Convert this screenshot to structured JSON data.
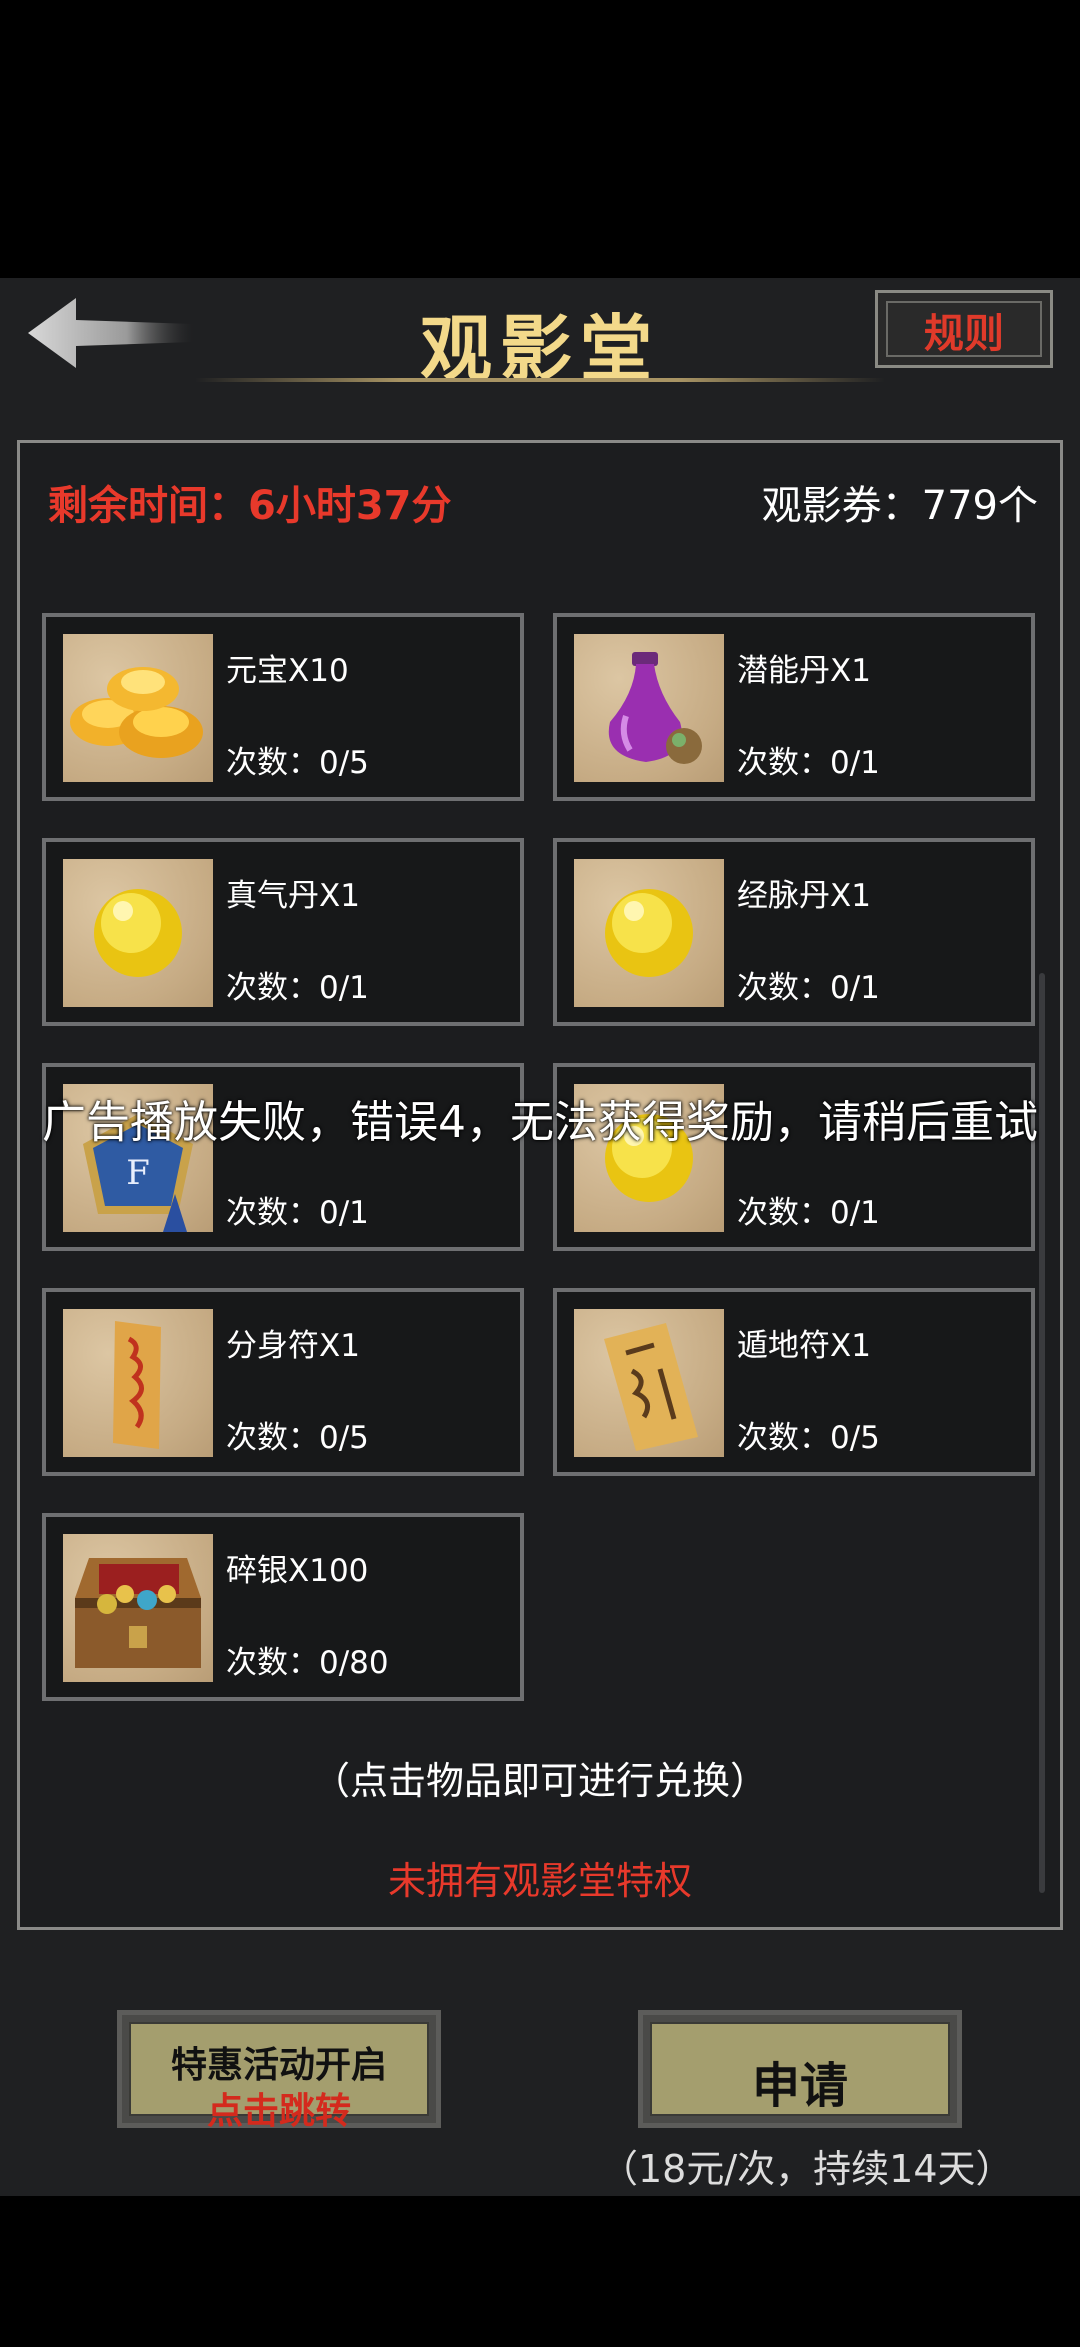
{
  "header": {
    "title": "观影堂",
    "rules_label": "规则"
  },
  "status": {
    "remaining_time": "剩余时间：6小时37分",
    "tickets": "观影券：779个"
  },
  "items": [
    {
      "name": "元宝X10",
      "count": "次数：0/5",
      "icon": "gold-ingot-icon"
    },
    {
      "name": "潜能丹X1",
      "count": "次数：0/1",
      "icon": "potion-vase-icon"
    },
    {
      "name": "真气丹X1",
      "count": "次数：0/1",
      "icon": "yellow-pill-icon"
    },
    {
      "name": "经脉丹X1",
      "count": "次数：0/1",
      "icon": "yellow-pill-icon"
    },
    {
      "name": "",
      "count": "次数：0/1",
      "icon": "badge-token-icon"
    },
    {
      "name": "",
      "count": "次数：0/1",
      "icon": "yellow-pill-icon"
    },
    {
      "name": "分身符X1",
      "count": "次数：0/5",
      "icon": "talisman-icon"
    },
    {
      "name": "遁地符X1",
      "count": "次数：0/5",
      "icon": "talisman-scroll-icon"
    },
    {
      "name": "碎银X100",
      "count": "次数：0/80",
      "icon": "treasure-chest-icon"
    }
  ],
  "hint": "（点击物品即可进行兑换）",
  "no_privilege": "未拥有观影堂特权",
  "toast": "广告播放失败，错误4，无法获得奖励，请稍后重试",
  "promo_button": {
    "line1": "特惠活动开启",
    "line2": "点击跳转"
  },
  "apply_button": "申请",
  "price_note": "（18元/次，持续14天）",
  "colors": {
    "accent_red": "#e8392b",
    "title_gold": "#f3d98a",
    "button_olive": "#a49e6e"
  }
}
